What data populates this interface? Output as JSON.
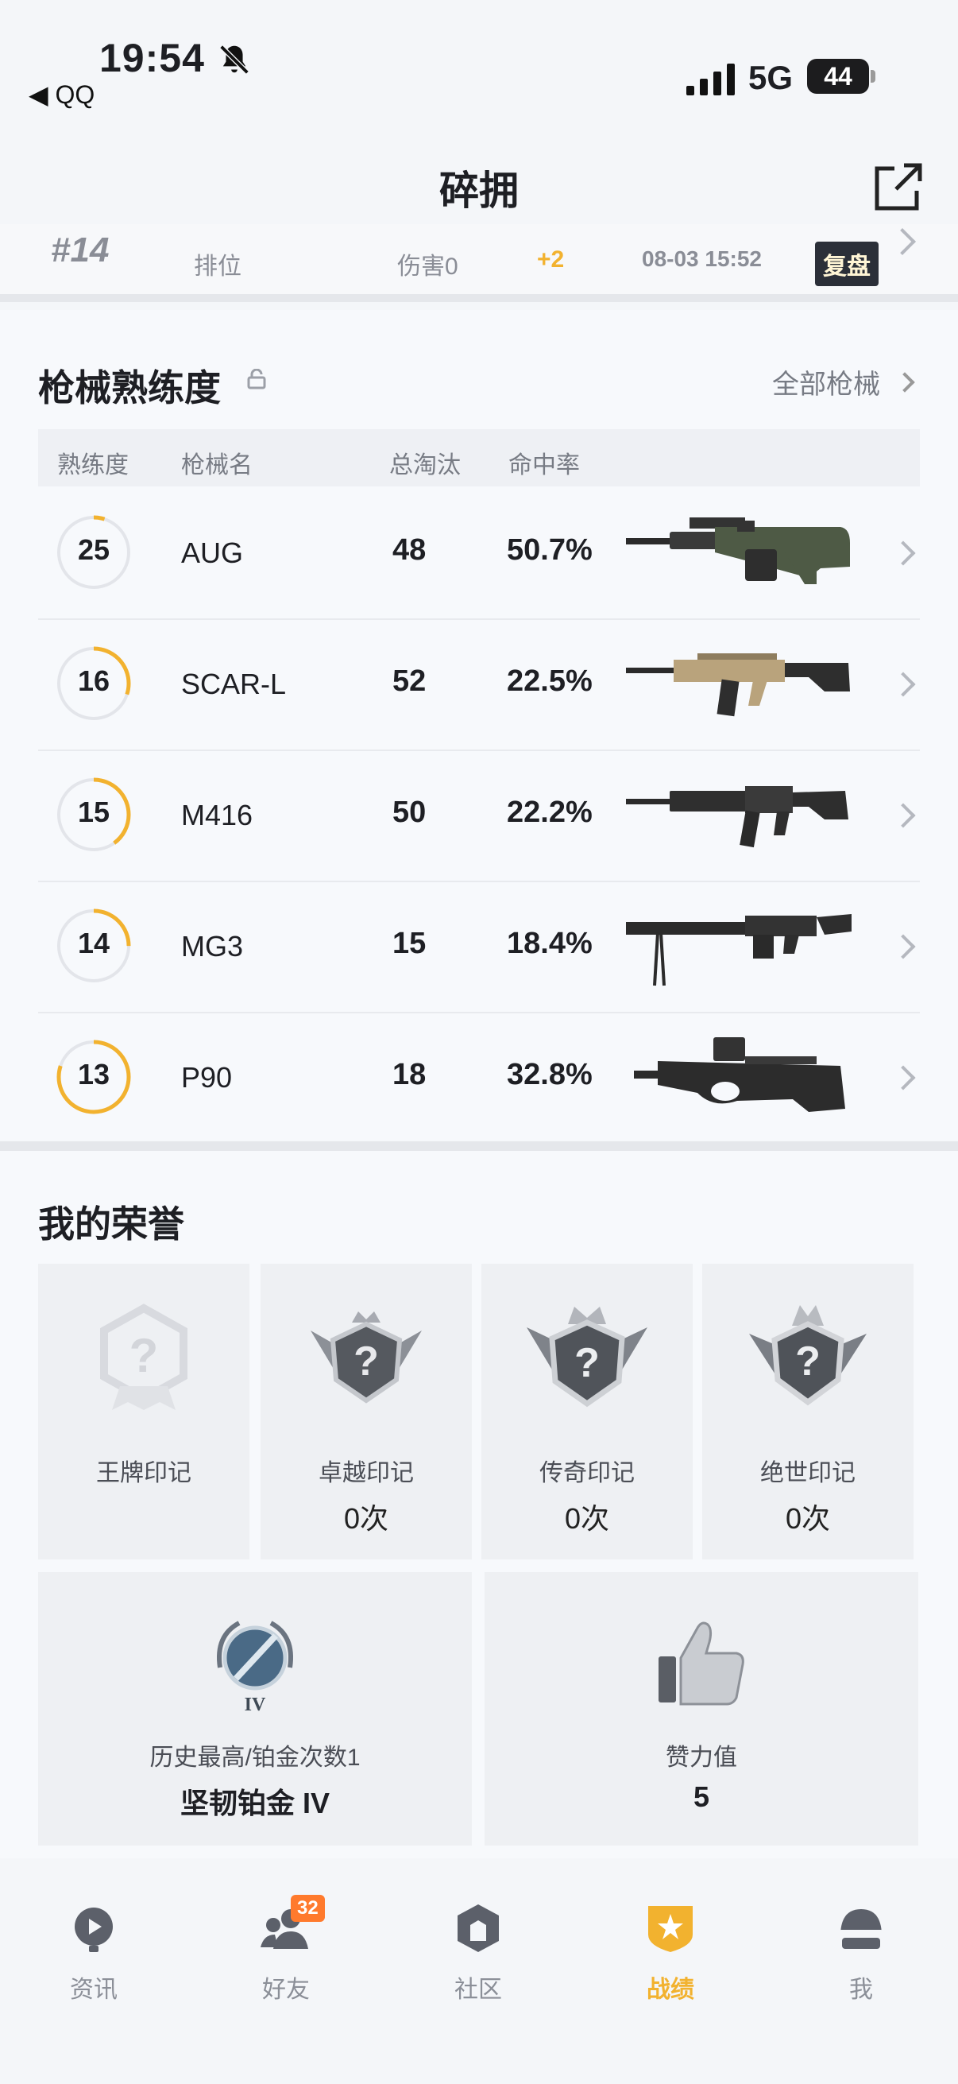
{
  "status_bar": {
    "time": "19:54",
    "back_label": "◀ QQ",
    "network": "5G",
    "battery": "44"
  },
  "header": {
    "title": "碎拥"
  },
  "last_match": {
    "rank": "#14",
    "mode": "排位",
    "damage": "伤害0",
    "delta": "+2",
    "time": "08-03 15:52",
    "review_label": "复盘"
  },
  "weapon_mastery": {
    "title": "枪械熟练度",
    "all_link": "全部枪械",
    "columns": [
      "熟练度",
      "枪械名",
      "总淘汰",
      "命中率"
    ],
    "rows": [
      {
        "level": "25",
        "name": "AUG",
        "kills": "48",
        "accuracy": "50.7%",
        "progress": 0.05,
        "image": "aug-rifle-icon"
      },
      {
        "level": "16",
        "name": "SCAR-L",
        "kills": "52",
        "accuracy": "22.5%",
        "progress": 0.3,
        "image": "scar-l-rifle-icon"
      },
      {
        "level": "15",
        "name": "M416",
        "kills": "50",
        "accuracy": "22.2%",
        "progress": 0.4,
        "image": "m416-rifle-icon"
      },
      {
        "level": "14",
        "name": "MG3",
        "kills": "15",
        "accuracy": "18.4%",
        "progress": 0.25,
        "image": "mg3-machine-gun-icon"
      },
      {
        "level": "13",
        "name": "P90",
        "kills": "18",
        "accuracy": "32.8%",
        "progress": 0.8,
        "image": "p90-smg-icon"
      }
    ]
  },
  "honors": {
    "title": "我的荣誉",
    "badges": [
      {
        "name": "王牌印记",
        "count": "",
        "icon": "ace-mark-icon"
      },
      {
        "name": "卓越印记",
        "count": "0次",
        "icon": "excellence-mark-icon"
      },
      {
        "name": "传奇印记",
        "count": "0次",
        "icon": "legend-mark-icon"
      },
      {
        "name": "绝世印记",
        "count": "0次",
        "icon": "peerless-mark-icon"
      }
    ],
    "rank_card": {
      "label": "历史最高/铂金次数1",
      "value": "坚韧铂金 IV",
      "icon": "platinum-rank-icon"
    },
    "likes_card": {
      "label": "赞力值",
      "value": "5",
      "icon": "thumbs-up-icon"
    }
  },
  "tab_bar": {
    "tabs": [
      {
        "label": "资讯",
        "icon": "news-icon"
      },
      {
        "label": "好友",
        "icon": "friends-icon",
        "badge": "32"
      },
      {
        "label": "社区",
        "icon": "community-icon"
      },
      {
        "label": "战绩",
        "icon": "record-icon",
        "active": true
      },
      {
        "label": "我",
        "icon": "helmet-icon"
      }
    ]
  },
  "colors": {
    "accent": "#f2b22f",
    "badge": "#ff7a2d",
    "text": "#1e1f24",
    "muted": "#8b8f98"
  }
}
